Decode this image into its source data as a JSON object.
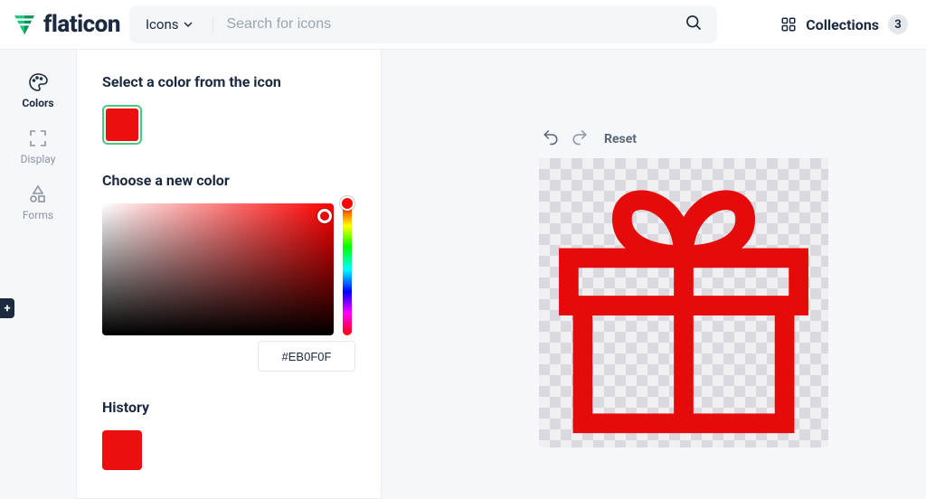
{
  "brand": "flaticon",
  "header": {
    "dropdown_label": "Icons",
    "search_placeholder": "Search for icons",
    "collections_label": "Collections",
    "collections_count": "3"
  },
  "rail": {
    "colors": "Colors",
    "display": "Display",
    "forms": "Forms"
  },
  "panel": {
    "select_title": "Select a color from the icon",
    "choose_title": "Choose a new color",
    "history_title": "History",
    "hex_value": "#EB0F0F",
    "current_swatch": "#EB0F0F",
    "history_swatch": "#EB0F0F"
  },
  "canvas": {
    "reset_label": "Reset",
    "icon_color": "#e60b0b"
  }
}
